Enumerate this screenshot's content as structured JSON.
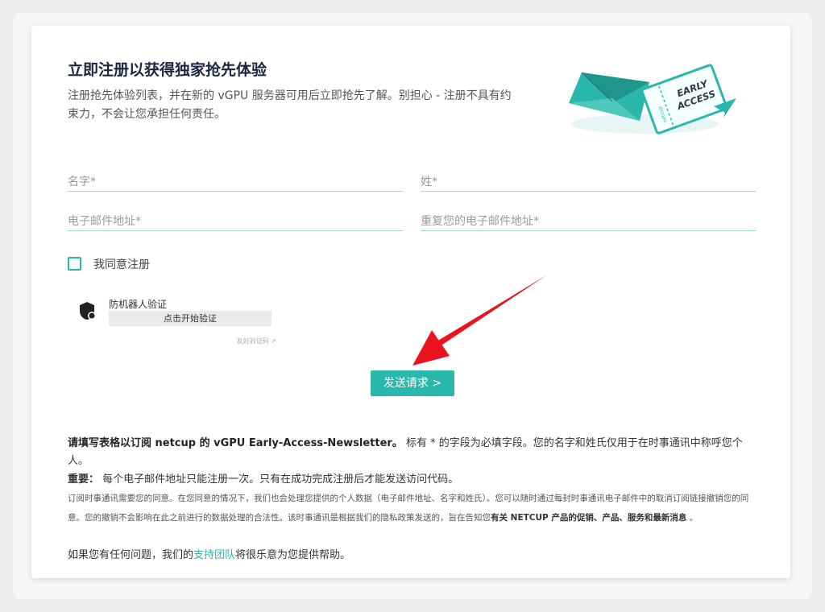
{
  "header": {
    "title": "立即注册以获得独家抢先体验",
    "intro": "注册抢先体验列表，并在新的 vGPU 服务器可用后立即抢先了解。别担心 - 注册不具有约束力，不会让您承担任何责任。"
  },
  "illustration": {
    "ticket_line1": "EARLY",
    "ticket_line2": "ACCESS",
    "ticket_stub": "netcup",
    "icons": [
      "envelope-icon",
      "ticket-icon",
      "paper-plane-icon"
    ]
  },
  "form": {
    "first_name_placeholder": "名字*",
    "last_name_placeholder": "姓*",
    "email_placeholder": "电子邮件地址*",
    "email_repeat_placeholder": "重复您的电子邮件地址*",
    "agree_label": "我同意注册",
    "agree_checked": false,
    "submit_label": "发送请求 >"
  },
  "captcha": {
    "title": "防机器人验证",
    "button_label": "点击开始验证",
    "footer": "友好验证码 ↗"
  },
  "info": {
    "p1_bold": "请填写表格以订阅 netcup 的 vGPU Early-Access-Newsletter。",
    "p1_rest": " 标有 * 的字段为必填字段。您的名字和姓氏仅用于在时事通讯中称呼您个人。",
    "p2_bold": "重要：",
    "p2_rest": " 每个电子邮件地址只能注册一次。只有在成功完成注册后才能发送访问代码。",
    "p3_text": "订阅时事通讯需要您的同意。在您同意的情况下，我们也会处理您提供的个人数据（电子邮件地址、名字和姓氏）。您可以随时通过每封时事通讯电子邮件中的取消订阅链接撤销您的同意。您的撤销不会影响在此之前进行的数据处理的合法性。该时事通讯是根据我们的隐私政策发送的，旨在告知您",
    "p3_bold": "有关 NETCUP 产品的促销、产品、服务和最新消息",
    "p3_end": " 。",
    "p4_before": "如果您有任何问题，我们的",
    "p4_link": "支持团队",
    "p4_after": "将很乐意为您提供帮助。"
  },
  "colors": {
    "accent": "#2ab8ac",
    "title": "#1a2540",
    "arrow": "#e8141e",
    "input_line": "#9fd6d2"
  }
}
